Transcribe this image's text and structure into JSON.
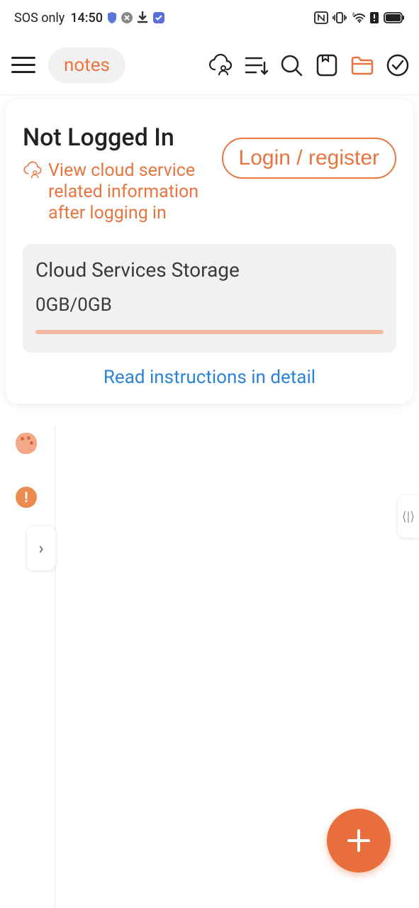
{
  "status": {
    "network": "SOS only",
    "time": "14:50"
  },
  "toolbar": {
    "notes_label": "notes"
  },
  "card": {
    "title": "Not Logged In",
    "subtitle": "View cloud service related information after logging in",
    "login_label": "Login / register",
    "storage_title": "Cloud Services Storage",
    "storage_value": "0GB/0GB",
    "read_link": "Read instructions in detail"
  },
  "exclaim": "!",
  "expand_chevron": "›",
  "collapse_glyph": "⟨|⟩"
}
